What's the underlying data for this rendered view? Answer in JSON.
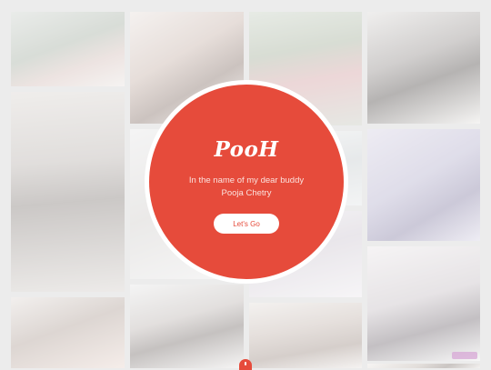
{
  "hero": {
    "title": "PooH",
    "subtitle": "In the name of my dear buddy Pooja Chetry",
    "cta_label": "Let's Go"
  },
  "colors": {
    "accent": "#e64b3b",
    "ring": "#ffffff",
    "background": "#ececec"
  },
  "gallery": {
    "photo_count": 14
  }
}
